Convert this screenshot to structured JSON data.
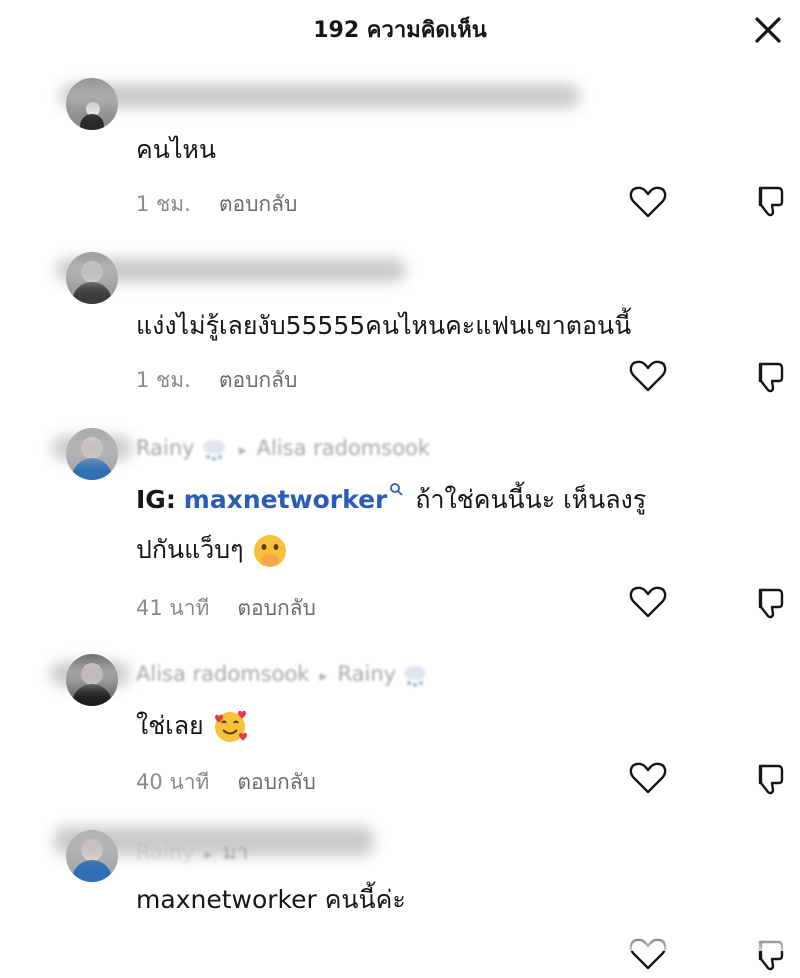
{
  "header": {
    "title": "192 ความคิดเห็น",
    "close_icon": "close-icon"
  },
  "comments": [
    {
      "author": "",
      "body": "คนไหน",
      "time": "1 ชม.",
      "reply_label": "ตอบกลับ"
    },
    {
      "author": "",
      "body": "แง่งไม่รู้เลยงับ55555คนไหนคะแฟนเขาตอนนี้",
      "time": "1 ชม.",
      "reply_label": "ตอบกลับ"
    },
    {
      "author": "Rainy",
      "reply_to": "Alisa radomsook",
      "prefix": "IG:",
      "mention": "maxnetworker",
      "body_line1": "ถ้าใช่คนนี้นะ เห็นลงรู",
      "body_line2": "ปกันแว็บๆ",
      "emoji": "hand-over-mouth-emoji",
      "time": "41 นาที",
      "reply_label": "ตอบกลับ"
    },
    {
      "author": "Alisa radomsook",
      "reply_to": "Rainy",
      "body": "ใช่เลย",
      "emoji": "smiling-face-with-hearts-emoji",
      "time": "40 นาที",
      "reply_label": "ตอบกลับ"
    },
    {
      "author": "Rainy",
      "reply_to": "มา",
      "body": "maxnetworker คนนี้ค่ะ",
      "time": "",
      "reply_label": ""
    }
  ],
  "icons": {
    "like": "heart-outline-icon",
    "dislike": "thumbs-down-outline-icon"
  },
  "colors": {
    "mention": "#2b5db8",
    "meta": "#8a8a8a",
    "text": "#161616"
  }
}
